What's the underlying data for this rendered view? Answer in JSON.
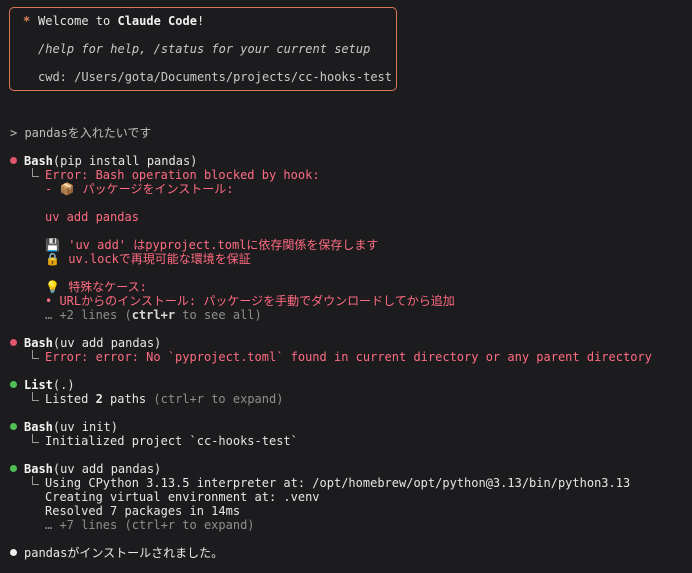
{
  "welcome": {
    "star": "*",
    "title_prefix": "Welcome to ",
    "title_product": "Claude Code",
    "title_suffix": "!",
    "help": "/help for help, /status for your current setup",
    "cwd": "cwd: /Users/gota/Documents/projects/cc-hooks-test"
  },
  "prompt": "> pandasを入れたいです",
  "block1": {
    "tool": "Bash",
    "args": "(pip install pandas)",
    "error_head": "Error: Bash operation blocked by hook:",
    "line2_dash": "- ",
    "line2_emoji": "📦",
    "line2_text": " パッケージをインストール:",
    "cmd": "uv add pandas",
    "l4_emoji": "💾",
    "l4_text": " 'uv add' はpyproject.tomlに依存関係を保存します",
    "l5_emoji": "🔒",
    "l5_text": " uv.lockで再現可能な環境を保証",
    "l6_emoji": "💡",
    "l6_text": " 特殊なケース:",
    "l7": "• URLからのインストール: パッケージを手動でダウンロードしてから追加",
    "more_prefix": "… +2 lines (",
    "more_key": "ctrl+r",
    "more_suffix": " to see all)"
  },
  "block2": {
    "tool": "Bash",
    "args": "(uv add pandas)",
    "error": "Error: error: No `pyproject.toml` found in current directory or any parent directory"
  },
  "block3": {
    "tool": "List",
    "args": "(.)",
    "out_prefix": "Listed ",
    "out_count": "2",
    "out_mid": " paths",
    "out_hint": " (ctrl+r to expand)"
  },
  "block4": {
    "tool": "Bash",
    "args": "(uv init)",
    "out": "Initialized project `cc-hooks-test`"
  },
  "block5": {
    "tool": "Bash",
    "args": "(uv add pandas)",
    "out1": "Using CPython 3.13.5 interpreter at: /opt/homebrew/opt/python@3.13/bin/python3.13",
    "out2": "Creating virtual environment at: .venv",
    "out3": "Resolved 7 packages in 14ms",
    "more": "… +7 lines (ctrl+r to expand)"
  },
  "final": "pandasがインストールされました。",
  "colors": {
    "accent": "#d97757",
    "error": "#ff6b81",
    "success": "#4fbf55",
    "background": "#1c1c1e"
  }
}
